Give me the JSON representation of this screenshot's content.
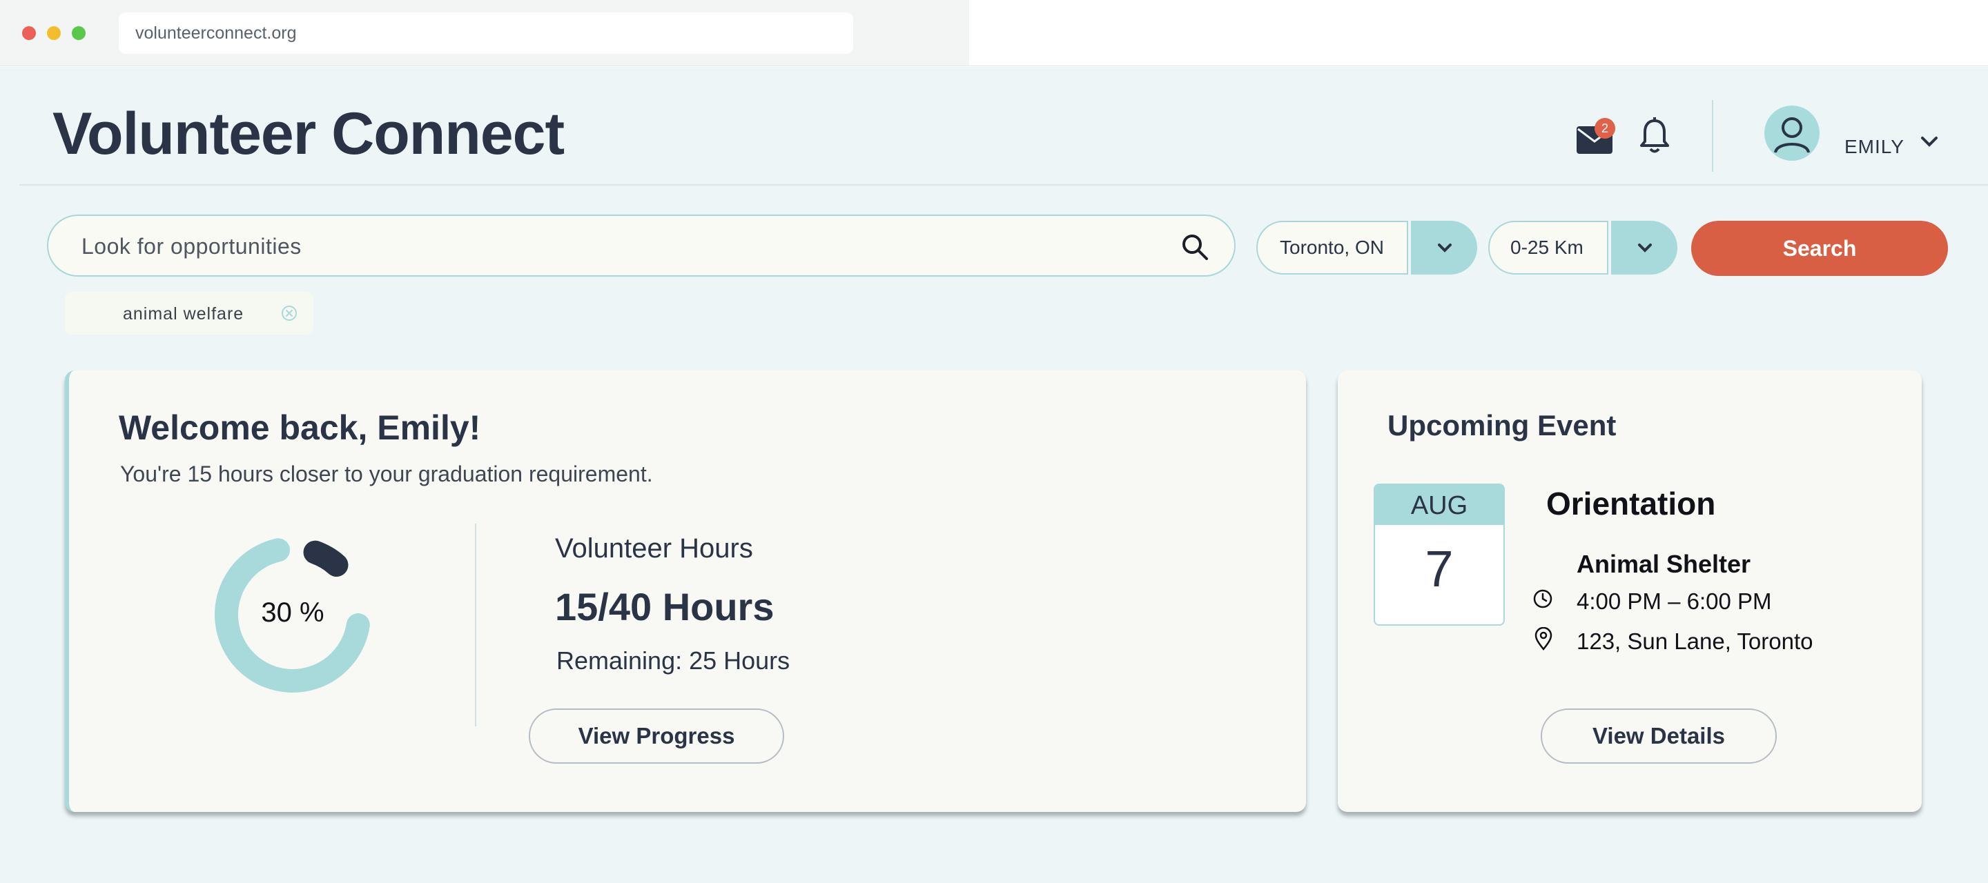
{
  "browser": {
    "url": "volunteerconnect.org"
  },
  "header": {
    "title": "Volunteer Connect",
    "mail_badge_count": "2",
    "user_name": "EMILY"
  },
  "search": {
    "placeholder": "Look for opportunities",
    "location": "Toronto, ON",
    "distance": "0-25 Km",
    "button_label": "Search",
    "tags": [
      "animal welfare"
    ]
  },
  "welcome_card": {
    "title": "Welcome back, Emily!",
    "subtitle": "You're 15 hours closer to your graduation requirement.",
    "progress_percent": 30,
    "progress_label": "30 %",
    "hours_label": "Volunteer Hours",
    "hours_value": "15/40 Hours",
    "remaining": "Remaining: 25 Hours",
    "button_label": "View Progress"
  },
  "event_card": {
    "title": "Upcoming Event",
    "month": "AUG",
    "day": "7",
    "event_name": "Orientation",
    "place": "Animal Shelter",
    "time": "4:00 PM – 6:00 PM",
    "address": "123, Sun Lane, Toronto",
    "button_label": "View Details"
  },
  "colors": {
    "accent_teal": "#a8d9db",
    "search_button": "#d85e44",
    "dark_text": "#2b3446",
    "badge": "#e0614a"
  },
  "icons": [
    "mail-icon",
    "bell-icon",
    "user-avatar-icon",
    "chevron-down-icon",
    "search-icon",
    "close-circle-icon",
    "clock-icon",
    "location-pin-icon"
  ]
}
